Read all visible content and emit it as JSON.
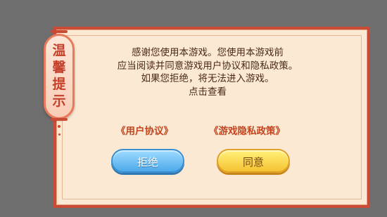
{
  "dialog": {
    "tab_title": [
      "温",
      "馨",
      "提",
      "示"
    ],
    "message_lines": [
      "感谢您使用本游戏。您使用本游戏前",
      "应当阅读并同意游戏用户协议和隐私政策。",
      "如果您拒绝，将无法进入游戏。",
      "点击查看"
    ],
    "links": {
      "user_agreement": "《用户协议》",
      "privacy_policy": "《游戏隐私政策》"
    },
    "buttons": {
      "reject": "拒绝",
      "agree": "同意"
    }
  },
  "colors": {
    "border": "#c94a35",
    "panel": "#fbe9d3",
    "link": "#c2451f",
    "reject_button": "#4da9ec",
    "agree_button": "#f6c232"
  }
}
